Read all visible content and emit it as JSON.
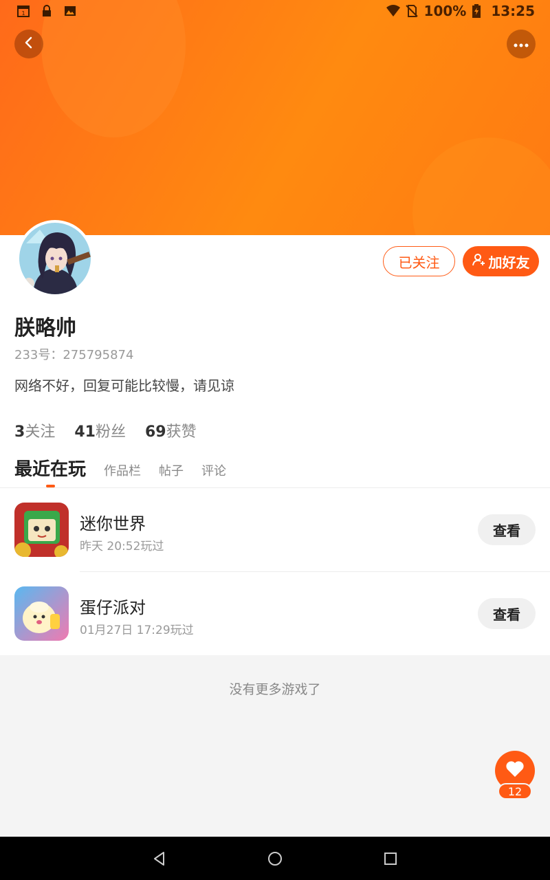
{
  "status_bar": {
    "battery": "100%",
    "time": "13:25",
    "left_icons": [
      "calendar-icon",
      "lock-icon",
      "image-icon"
    ],
    "right_icons": [
      "wifi-icon",
      "no-sim-icon",
      "battery-charging-icon"
    ]
  },
  "header": {
    "back_icon": "chevron-left-icon",
    "more_icon": "more-dots-icon"
  },
  "profile": {
    "nickname": "朕略帅",
    "uid": "233号：275795874",
    "bio": "网络不好，回复可能比较慢，请见谅",
    "follow_label": "已关注",
    "add_friend_label": "加好友"
  },
  "stats": {
    "following_count": "3",
    "following_label": "关注",
    "fans_count": "41",
    "fans_label": "粉丝",
    "likes_count": "69",
    "likes_label": "获赞"
  },
  "tabs": [
    {
      "label": "最近在玩",
      "active": true
    },
    {
      "label": "作品栏",
      "active": false
    },
    {
      "label": "帖子",
      "active": false
    },
    {
      "label": "评论",
      "active": false
    }
  ],
  "games": [
    {
      "name": "迷你世界",
      "played": "昨天 20:52玩过",
      "button": "查看"
    },
    {
      "name": "蛋仔派对",
      "played": "01月27日 17:29玩过",
      "button": "查看"
    }
  ],
  "empty_text": "没有更多游戏了",
  "favorite": {
    "count": "12",
    "icon": "heart-icon"
  },
  "nav_bar": {
    "icons": [
      "back-triangle-icon",
      "home-circle-icon",
      "recents-square-icon"
    ]
  },
  "colors": {
    "accent": "#ff5a14",
    "banner": "#ff7a12"
  }
}
